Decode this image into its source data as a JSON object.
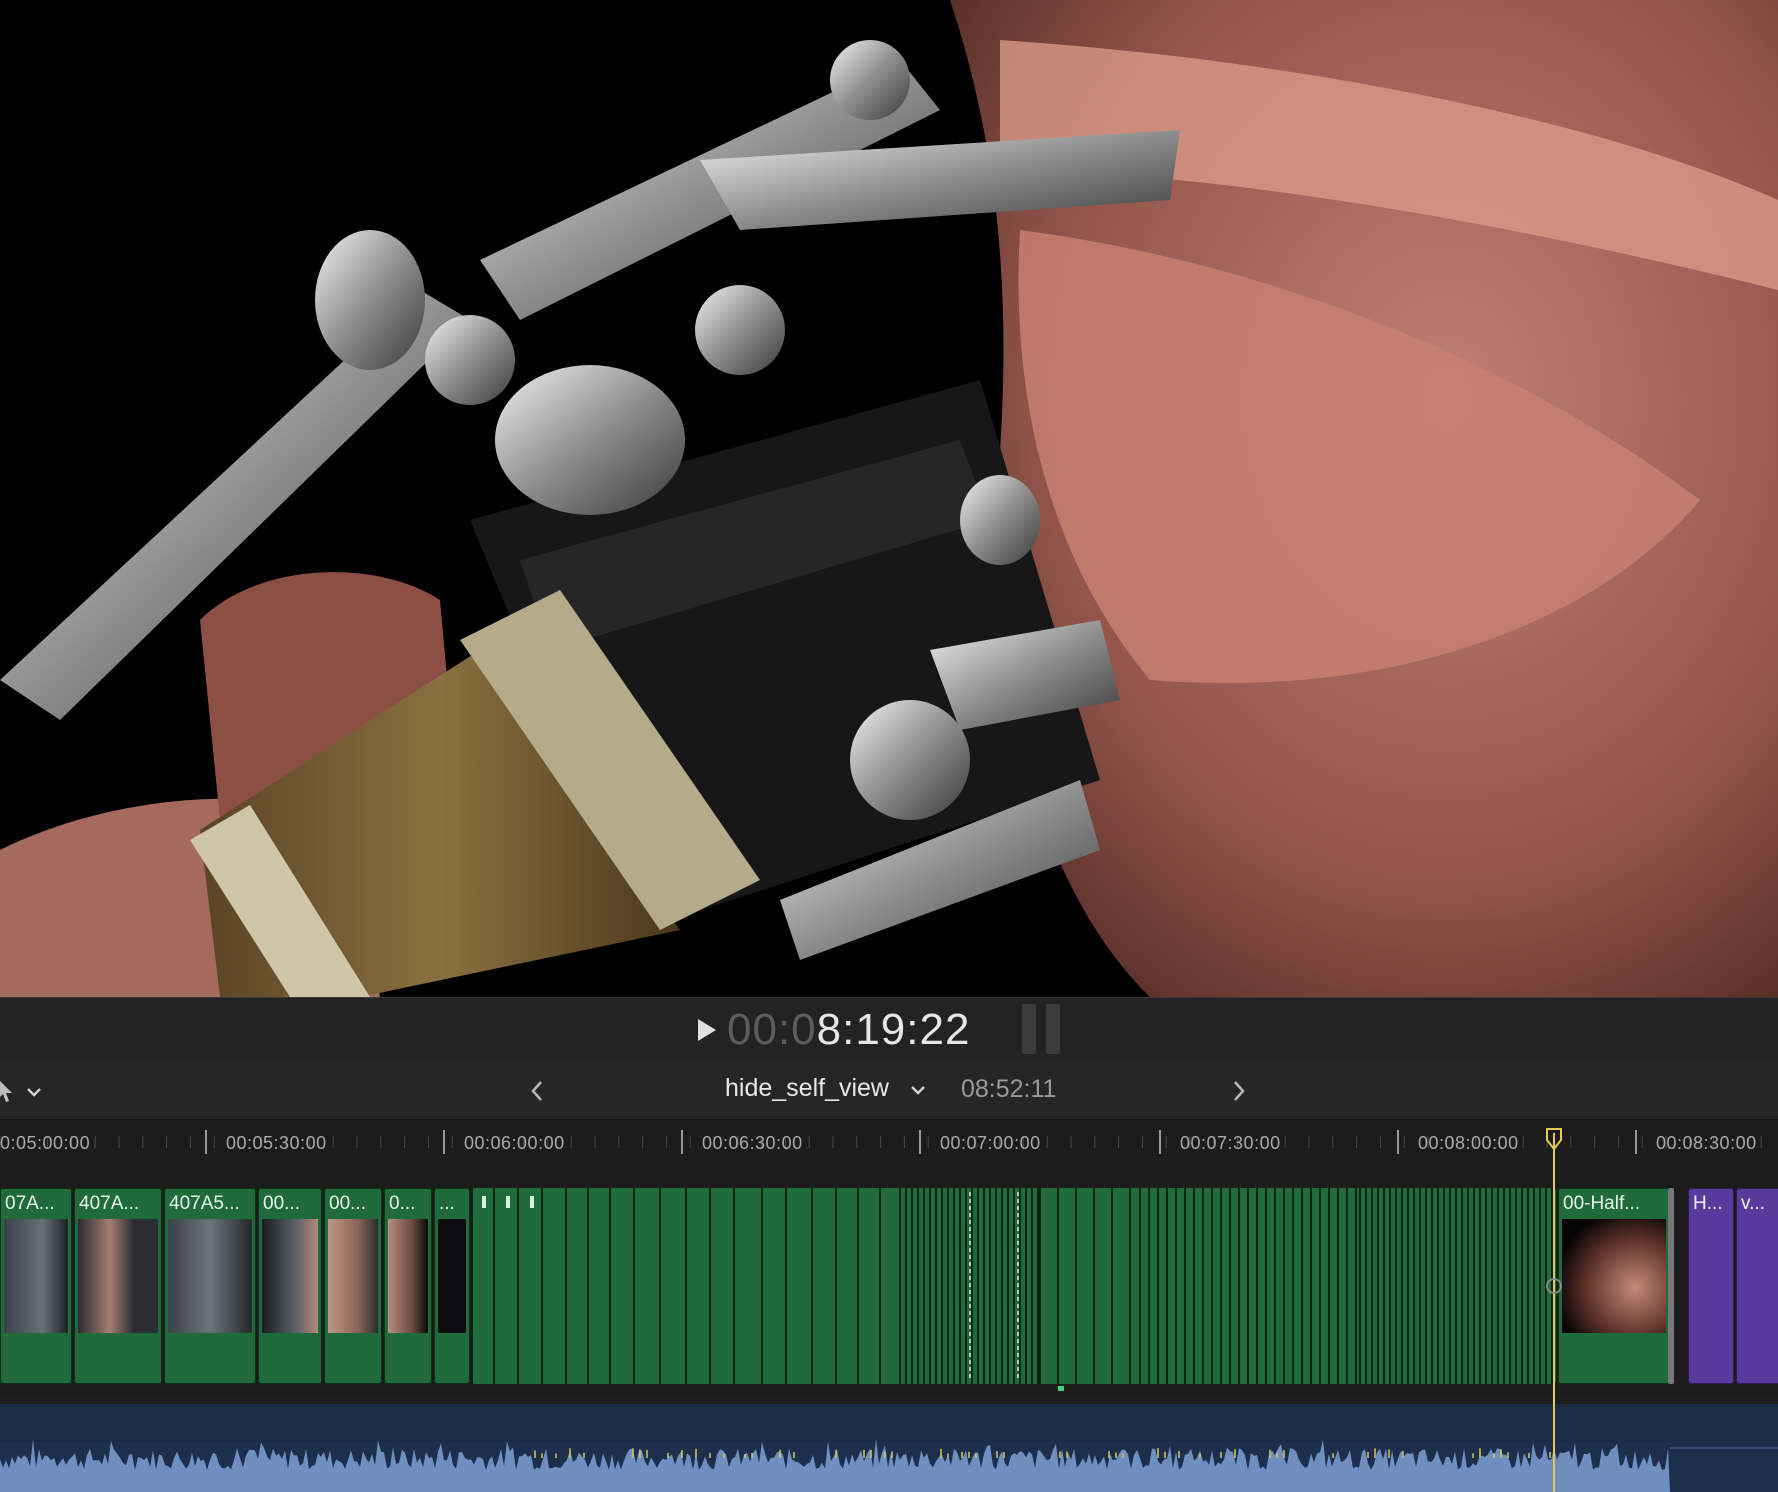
{
  "transport": {
    "timecode_dim": "00:0",
    "timecode_lit": "8:19:22"
  },
  "timeline_header": {
    "project_name": "hide_self_view",
    "project_duration": "08:52:11"
  },
  "ruler": {
    "labels": [
      "0:05:00:00",
      "00:05:30:00",
      "00:06:00:00",
      "00:06:30:00",
      "00:07:00:00",
      "00:07:30:00",
      "00:08:00:00",
      "00:08:30:00"
    ]
  },
  "clips": [
    {
      "name": "07A..."
    },
    {
      "name": "407A..."
    },
    {
      "name": "407A5..."
    },
    {
      "name": "00..."
    },
    {
      "name": "00..."
    },
    {
      "name": "0..."
    },
    {
      "name": "..."
    },
    {
      "name": "00-Half..."
    },
    {
      "name": "H..."
    },
    {
      "name": "v..."
    }
  ],
  "colors": {
    "clip_video": "#1f6b3b",
    "clip_connected": "#5a3a9c",
    "audio_bg": "#1e2f4d",
    "audio_wave": "#6f8fc0",
    "playhead": "#e6c84a"
  },
  "icons": [
    "play-icon",
    "select-tool-icon",
    "chevron-down-icon",
    "back-arrow-icon",
    "forward-arrow-icon"
  ]
}
